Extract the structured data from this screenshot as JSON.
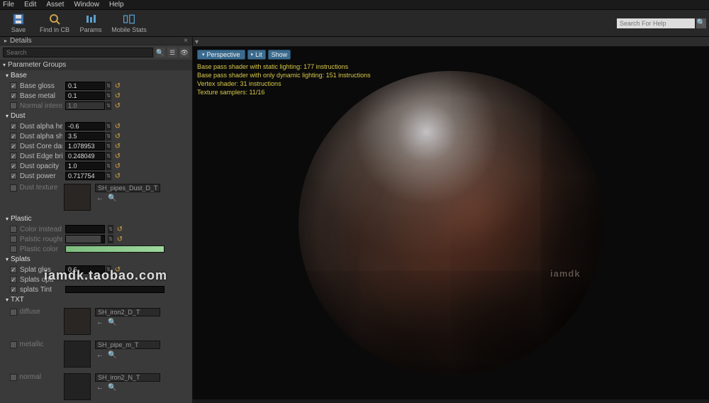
{
  "menu": {
    "items": [
      "File",
      "Edit",
      "Asset",
      "Window",
      "Help"
    ]
  },
  "toolbar": {
    "save": "Save",
    "find": "Find in CB",
    "params": "Params",
    "mobile": "Mobile Stats"
  },
  "help_search_placeholder": "Search For Help",
  "details_tab": "Details",
  "search_placeholder": "Search",
  "group_header": "Parameter Groups",
  "groups": {
    "base": {
      "label": "Base",
      "base_gloss": {
        "label": "Base gloss",
        "value": "0.1"
      },
      "base_metal": {
        "label": "Base metal",
        "value": "0.1"
      },
      "normal_intensity": {
        "label": "Normal intensity",
        "value": "1.0"
      }
    },
    "dust": {
      "label": "Dust",
      "alpha_height": {
        "label": "Dust alpha height",
        "value": "-0.6"
      },
      "alpha_sharp": {
        "label": "Dust alpha sharpnes",
        "value": "3.5"
      },
      "core_dark": {
        "label": "Dust Core darkness",
        "value": "1.078953"
      },
      "edge_bright": {
        "label": "Dust Edge brightnes",
        "value": "0.248049"
      },
      "opacity": {
        "label": "Dust opacity",
        "value": "1.0"
      },
      "power": {
        "label": "Dust power",
        "value": "0.717754"
      },
      "texture": {
        "label": "Dust texture",
        "name": "SH_pipes_Dust_D_T"
      }
    },
    "plastic": {
      "label": "Plastic",
      "color_instead": {
        "label": "Color instead of bas",
        "value": "0.0"
      },
      "roughness": {
        "label": "Palstic roughness",
        "value": "0.9"
      },
      "color": {
        "label": "Plastic color"
      }
    },
    "splats": {
      "label": "Splats",
      "glos": {
        "label": "Splat glos",
        "value": "0.6"
      },
      "opacity": {
        "label": "Splats opa"
      },
      "tint": {
        "label": "splats Tint"
      }
    },
    "txt": {
      "label": "TXT",
      "diffuse": {
        "label": "diffuse",
        "name": "SH_iron2_D_T"
      },
      "metallic": {
        "label": "metallic",
        "name": "SH_pipe_m_T"
      },
      "normal": {
        "label": "normal",
        "name": "SH_iron2_N_T"
      }
    }
  },
  "viewport": {
    "perspective": "Perspective",
    "lit": "Lit",
    "show": "Show",
    "stats": [
      "Base pass shader with static lighting: 177 instructions",
      "Base pass shader with only dynamic lighting: 151 instructions",
      "Vertex shader: 31 instructions",
      "Texture samplers: 11/16"
    ]
  },
  "watermark1": "iamdk.taobao.com",
  "watermark2": "iamdk"
}
